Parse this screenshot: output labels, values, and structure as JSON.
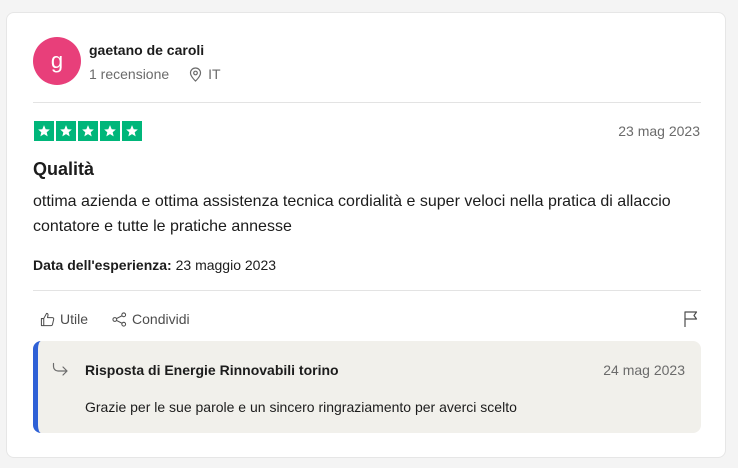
{
  "reviewer": {
    "avatar_letter": "g",
    "avatar_color": "#e83f7a",
    "name": "gaetano de caroli",
    "review_count": "1 recensione",
    "country": "IT",
    "location_icon": "location-pin-icon"
  },
  "review": {
    "rating": 5,
    "rating_max": 5,
    "star_color": "#00b67a",
    "date": "23 mag 2023",
    "title": "Qualità",
    "body": "ottima azienda e ottima assistenza tecnica cordialità e super veloci nella pratica di allaccio contatore e tutte le pratiche annesse",
    "experience_label": "Data dell'esperienza:",
    "experience_date": "23 maggio 2023"
  },
  "actions": {
    "useful_label": "Utile",
    "useful_icon": "thumbs-up-icon",
    "share_label": "Condividi",
    "share_icon": "share-icon",
    "report_icon": "flag-icon"
  },
  "reply": {
    "title": "Risposta di Energie Rinnovabili torino",
    "date": "24 mag 2023",
    "body": "Grazie per le sue parole e un sincero ringraziamento per averci scelto",
    "accent_color": "#2e60d6",
    "icon": "reply-arrow-icon"
  }
}
